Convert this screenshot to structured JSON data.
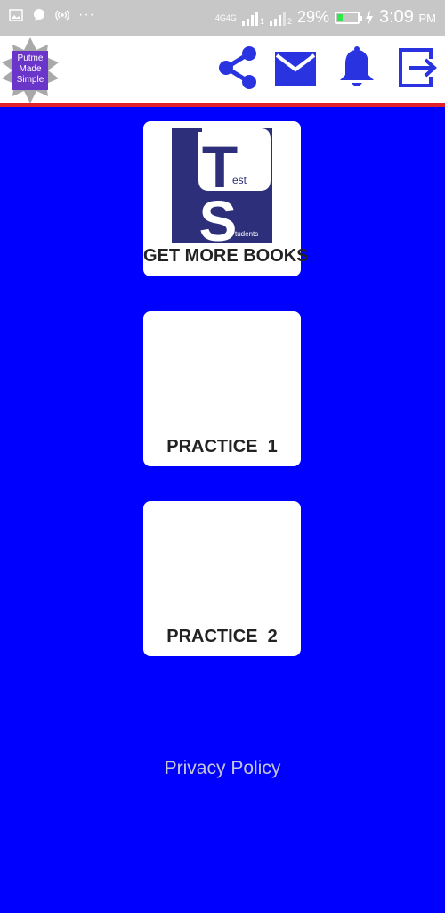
{
  "status_bar": {
    "network_1": "4G",
    "network_2": "4G",
    "sim1": "1",
    "sim2": "2",
    "battery_percent": "29%",
    "battery_level": 0.29,
    "time": "3:09",
    "ampm": "PM"
  },
  "header": {
    "logo_lines": [
      "Putme",
      "Made",
      "Simple"
    ],
    "icons": [
      "share-icon",
      "mail-icon",
      "bell-icon",
      "logout-icon"
    ]
  },
  "cards": [
    {
      "label": "GET MORE BOOKS",
      "image_letters": [
        "T",
        "est",
        "S",
        "tudents"
      ]
    },
    {
      "label": "PRACTICE  1"
    },
    {
      "label": "PRACTICE  2"
    }
  ],
  "footer": {
    "privacy_label": "Privacy Policy"
  },
  "colors": {
    "background": "#0000ff",
    "accent": "#2a33e0",
    "divider": "#e0202a",
    "logo_purple": "#6a35c9",
    "ts_navy": "#2e2f7a"
  }
}
